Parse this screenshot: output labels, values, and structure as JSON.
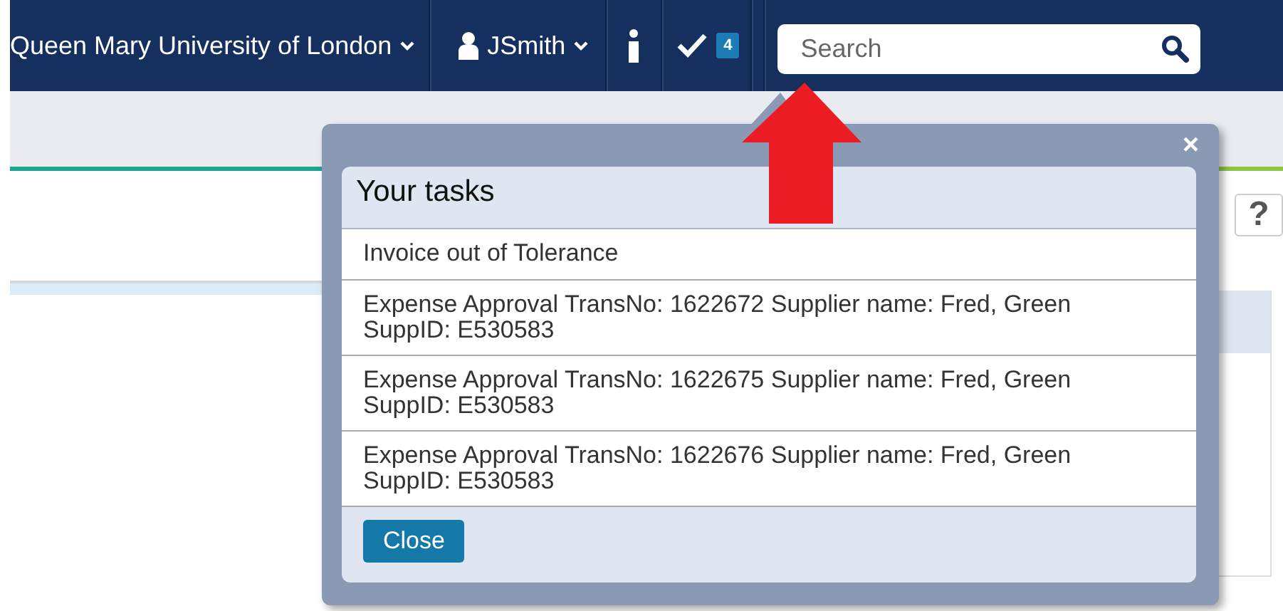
{
  "navbar": {
    "organization": "Queen Mary University of London",
    "user": "JSmith",
    "tasks_badge": "4",
    "search": {
      "placeholder": "Search"
    }
  },
  "help_button": "?",
  "tasks_popup": {
    "close": "×",
    "title": "Your tasks",
    "items": [
      {
        "lines": [
          "Invoice out of Tolerance"
        ]
      },
      {
        "lines": [
          "Expense Approval TransNo: 1622672 Supplier name: Fred, Green",
          "SuppID: E530583"
        ]
      },
      {
        "lines": [
          "Expense Approval TransNo: 1622675 Supplier name: Fred, Green",
          "SuppID: E530583"
        ]
      },
      {
        "lines": [
          "Expense Approval TransNo: 1622676 Supplier name: Fred, Green",
          "SuppID: E530583"
        ]
      }
    ],
    "button": "Close"
  }
}
